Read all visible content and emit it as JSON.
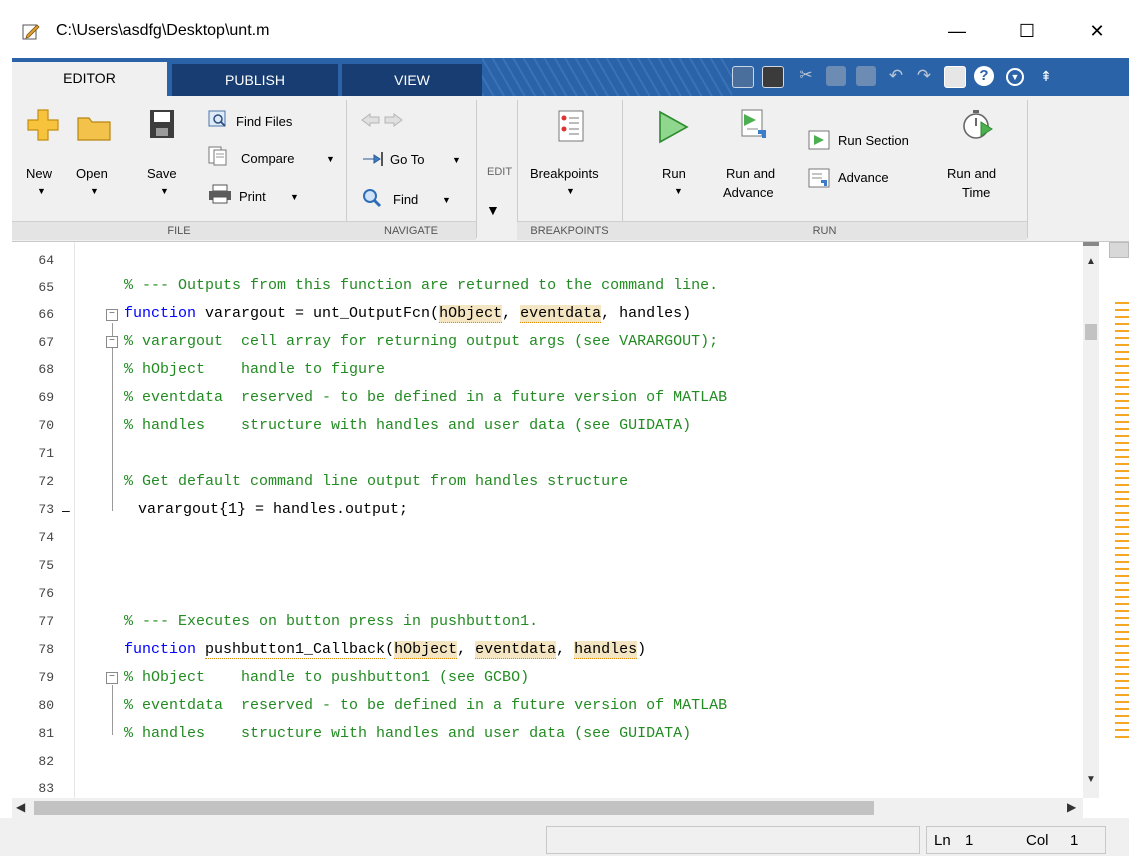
{
  "window": {
    "title": "C:\\Users\\asdfg\\Desktop\\unt.m",
    "minimize": "—",
    "maximize": "☐",
    "close": "✕"
  },
  "tabs": [
    {
      "label": "EDITOR"
    },
    {
      "label": "PUBLISH"
    },
    {
      "label": "VIEW"
    }
  ],
  "ribbon": {
    "file": {
      "section": "FILE",
      "new": "New",
      "open": "Open",
      "save": "Save",
      "find_files": "Find Files",
      "compare": "Compare",
      "print": "Print"
    },
    "navigate": {
      "section": "NAVIGATE",
      "goto": "Go To",
      "find": "Find"
    },
    "edit": {
      "section": "EDIT"
    },
    "breakpoints": {
      "section": "BREAKPOINTS",
      "label": "Breakpoints"
    },
    "run": {
      "section": "RUN",
      "run": "Run",
      "run_and_advance_1": "Run and",
      "run_and_advance_2": "Advance",
      "run_section": "Run Section",
      "advance": "Advance",
      "run_and_time_1": "Run and",
      "run_and_time_2": "Time"
    }
  },
  "code": {
    "line_numbers": [
      "64",
      "65",
      "66",
      "67",
      "68",
      "69",
      "70",
      "71",
      "72",
      "73",
      "74",
      "75",
      "76",
      "77",
      "78",
      "79",
      "80",
      "81",
      "82",
      "83"
    ],
    "l65": "% --- Outputs from this function are returned to the command line.",
    "l66_kw": "function",
    "l66_a": " varargout = unt_OutputFcn(",
    "l66_h1": "hObject",
    "l66_b": ", ",
    "l66_h2": "eventdata",
    "l66_c": ", handles)",
    "l67": "% varargout  cell array for returning output args (see VARARGOUT);",
    "l68": "% hObject    handle to figure",
    "l69": "% eventdata  reserved - to be defined in a future version of MATLAB",
    "l70": "% handles    structure with handles and user data (see GUIDATA)",
    "l72": "% Get default command line output from handles structure",
    "l73": "varargout{1} = handles.output;",
    "l73_marker": "–",
    "l77": "% --- Executes on button press in pushbutton1.",
    "l78_kw": "function",
    "l78_sp": " ",
    "l78_fn": "pushbutton1_Callback",
    "l78_a": "(",
    "l78_h1": "hObject",
    "l78_b": ", ",
    "l78_h2": "eventdata",
    "l78_c": ", ",
    "l78_h3": "handles",
    "l78_d": ")",
    "l79": "% hObject    handle to pushbutton1 (see GCBO)",
    "l80": "% eventdata  reserved - to be defined in a future version of MATLAB",
    "l81": "% handles    structure with handles and user data (see GUIDATA)"
  },
  "status": {
    "ln_label": "Ln",
    "ln_value": "1",
    "col_label": "Col",
    "col_value": "1"
  },
  "colors": {
    "tab_strip": "#2b63a8",
    "comment": "#228b22",
    "keyword": "#0000ff",
    "highlight": "#f5e6c3",
    "run_green": "#3cb371"
  }
}
